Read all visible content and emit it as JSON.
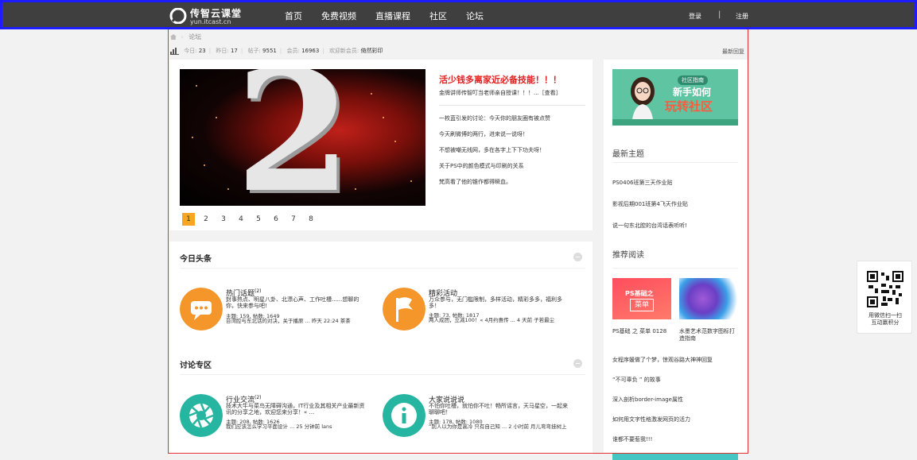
{
  "brand": {
    "name_cn": "传智云课堂",
    "name_en": "yun.itcast.cn"
  },
  "nav": {
    "items": [
      "首页",
      "免费视频",
      "直播课程",
      "社区",
      "论坛"
    ]
  },
  "auth": {
    "login": "登录",
    "separator": "|",
    "register": "注册"
  },
  "breadcrumb": {
    "current": "论坛"
  },
  "stats": {
    "today_label": "今日:",
    "today": "23",
    "yesterday_label": "昨日:",
    "yesterday": "17",
    "posts_label": "帖子:",
    "posts": "9551",
    "members_label": "会员:",
    "members": "16963",
    "welcome_label": "欢迎新会员:",
    "welcome_user": "倚然彩印",
    "latest_reply": "最新回复"
  },
  "slider": {
    "digit": "2",
    "pages": [
      "1",
      "2",
      "3",
      "4",
      "5",
      "6",
      "7",
      "8"
    ],
    "active_page": 1
  },
  "featured": {
    "title": "活少钱多离家近必备技能！！！",
    "subtitle": "金牌讲师传智叮当老师亲自授课！！！...［查看］",
    "items": [
      "一枚蓝引发的讨论：今天你的朋友圈有被点赞",
      "今天刷微博的两行，进来说一说呀！",
      "不想被嘲无线网，多在各字上下下功夫呀！",
      "关于PS中的颜色模式与印刷的关系",
      "梵高看了他的锥作都得瞬血。"
    ]
  },
  "headlines": {
    "title": "今日头条",
    "cards": [
      {
        "title": "热门话题",
        "count": "(2)",
        "desc": "封事热点、明星八卦、北漂心声、工作吐槽......想聊的你，快来参与吧!",
        "stats": "主题: 159, 帖数: 1649",
        "last": "台湾腔与东北话的对决，关于播原 ... 昨天 22:24 茶茶"
      },
      {
        "title": "精彩活动",
        "count": "",
        "desc": "万众参与，无门槛限制，多样活动，精彩多多，福利多多！",
        "stats": "主题: 73, 帖数: 1817",
        "last": "两人成团，立减100！« 4月约惠传 ... 4 天前 子若最尘"
      }
    ]
  },
  "discussion": {
    "title": "讨论专区",
    "cards": [
      {
        "title": "行业交流",
        "count": "(2)",
        "desc": "技术大牛与菜鸟无障碍沟通，IT行业及其相关产业最新资讯的分享之地，欢迎您来分享！« ...",
        "stats": "主题: 208, 帖数: 1626",
        "last": "我们应该怎么学习平面设计 ... 25 分钟前 lans"
      },
      {
        "title": "大家说说说",
        "count": "",
        "desc": "不怕你吐槽，就怕你不吐！畅所谣言，天马星空，一起来聊聊吧！",
        "stats": "主题: 178, 帖数: 1080",
        "last": "“别人以为你是高冷 只有自己知 ... 2 小时前 月儿弯弯挂树上"
      }
    ]
  },
  "sidebar": {
    "banner": {
      "tag": "社区指南",
      "line1": "新手如何",
      "line2": "玩转社区"
    },
    "latest_title": "最新主题",
    "latest": [
      "PS0406班第三天作业贴",
      "影视后期001班第4飞天作业贴",
      "说一句东北腔的台湾话表听听!"
    ],
    "recommend_title": "推荐阅读",
    "thumbs": [
      {
        "label": "PS基础之",
        "box": "菜单",
        "caption": "PS基础 之 菜单 0128"
      },
      {
        "caption": "水墨艺术范数字图标打造指南"
      }
    ],
    "recommend": [
      "女程序媛做了个梦，惊观谷路大神神回复",
      "“不可辜负 ” 的故事",
      "深入剖析border-image属性",
      "如何用文字性格激发网页的活力",
      "谁都不要惹我!!!"
    ]
  },
  "qr": {
    "line1": "用微信扫一扫",
    "line2": "互动赢积分"
  },
  "colors": {
    "topbar": "#3f3f3f",
    "accent_orange": "#f5a623",
    "accent_teal": "#26b5a0",
    "featured_red": "#e02020"
  }
}
